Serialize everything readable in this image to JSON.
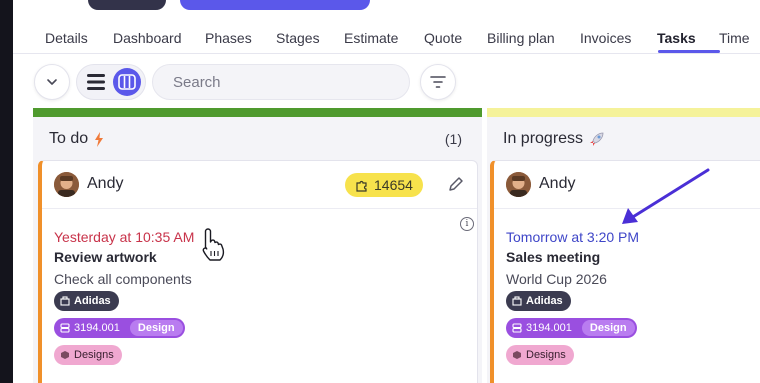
{
  "nav": {
    "tabs": [
      {
        "label": "Details"
      },
      {
        "label": "Dashboard"
      },
      {
        "label": "Phases"
      },
      {
        "label": "Stages"
      },
      {
        "label": "Estimate"
      },
      {
        "label": "Quote"
      },
      {
        "label": "Billing plan"
      },
      {
        "label": "Invoices"
      },
      {
        "label": "Tasks",
        "active": true
      },
      {
        "label": "Time"
      }
    ]
  },
  "toolbar": {
    "collapse_icon": "chevron-down-icon",
    "view_list_icon": "list-view-icon",
    "view_board_icon": "board-view-icon",
    "search_placeholder": "Search",
    "filter_icon": "filter-icon"
  },
  "colors": {
    "accent": "#5b58ea",
    "todo_bar": "#4f9a2e",
    "progress_bar": "#f5f29a",
    "card_border": "#f0902a",
    "id_badge": "#f7e24c",
    "due_overdue": "#c8334a",
    "due_upcoming": "#3f46c8"
  },
  "columns": [
    {
      "title": "To do",
      "title_icon": "lightning-icon",
      "count": "(1)",
      "cards": [
        {
          "owner": "Andy",
          "id": "14654",
          "due": "Yesterday at 10:35 AM",
          "title": "Review artwork",
          "subtitle": "Check all components",
          "client": "Adidas",
          "project_number": "3194.001",
          "project_tag": "Design",
          "category": "Designs"
        }
      ]
    },
    {
      "title": "In progress",
      "title_icon": "rocket-icon",
      "cards": [
        {
          "owner": "Andy",
          "due": "Tomorrow at 3:20 PM",
          "title": "Sales meeting",
          "subtitle": "World Cup 2026",
          "client": "Adidas",
          "project_number": "3194.001",
          "project_tag": "Design",
          "category": "Designs"
        }
      ]
    }
  ]
}
